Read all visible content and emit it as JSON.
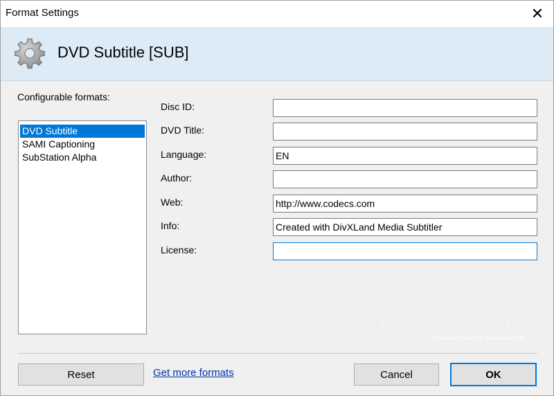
{
  "window": {
    "title": "Format Settings",
    "close_glyph": "✕"
  },
  "header": {
    "icon": "gear-icon",
    "title": "DVD Subtitle [SUB]"
  },
  "formats": {
    "label": "Configurable formats:",
    "items": [
      {
        "label": "DVD Subtitle",
        "selected": true
      },
      {
        "label": "SAMI Captioning",
        "selected": false
      },
      {
        "label": "SubStation Alpha",
        "selected": false
      }
    ]
  },
  "fields": [
    {
      "label": "Disc ID:",
      "value": ""
    },
    {
      "label": "DVD Title:",
      "value": ""
    },
    {
      "label": "Language:",
      "value": "EN"
    },
    {
      "label": "Author:",
      "value": ""
    },
    {
      "label": "Web:",
      "value": "http://www.codecs.com"
    },
    {
      "label": "Info:",
      "value": "Created with DivXLand Media Subtitler"
    },
    {
      "label": "License:",
      "value": ""
    }
  ],
  "watermark": {
    "text": "codecs.com",
    "tagline": "Download codecs & multimedia tools"
  },
  "footer": {
    "reset_label": "Reset",
    "more_formats_link": "Get more formats",
    "cancel_label": "Cancel",
    "ok_label": "OK"
  },
  "colors": {
    "accent": "#0078d7",
    "header_bg": "#dcebf5",
    "link": "#0033aa"
  }
}
